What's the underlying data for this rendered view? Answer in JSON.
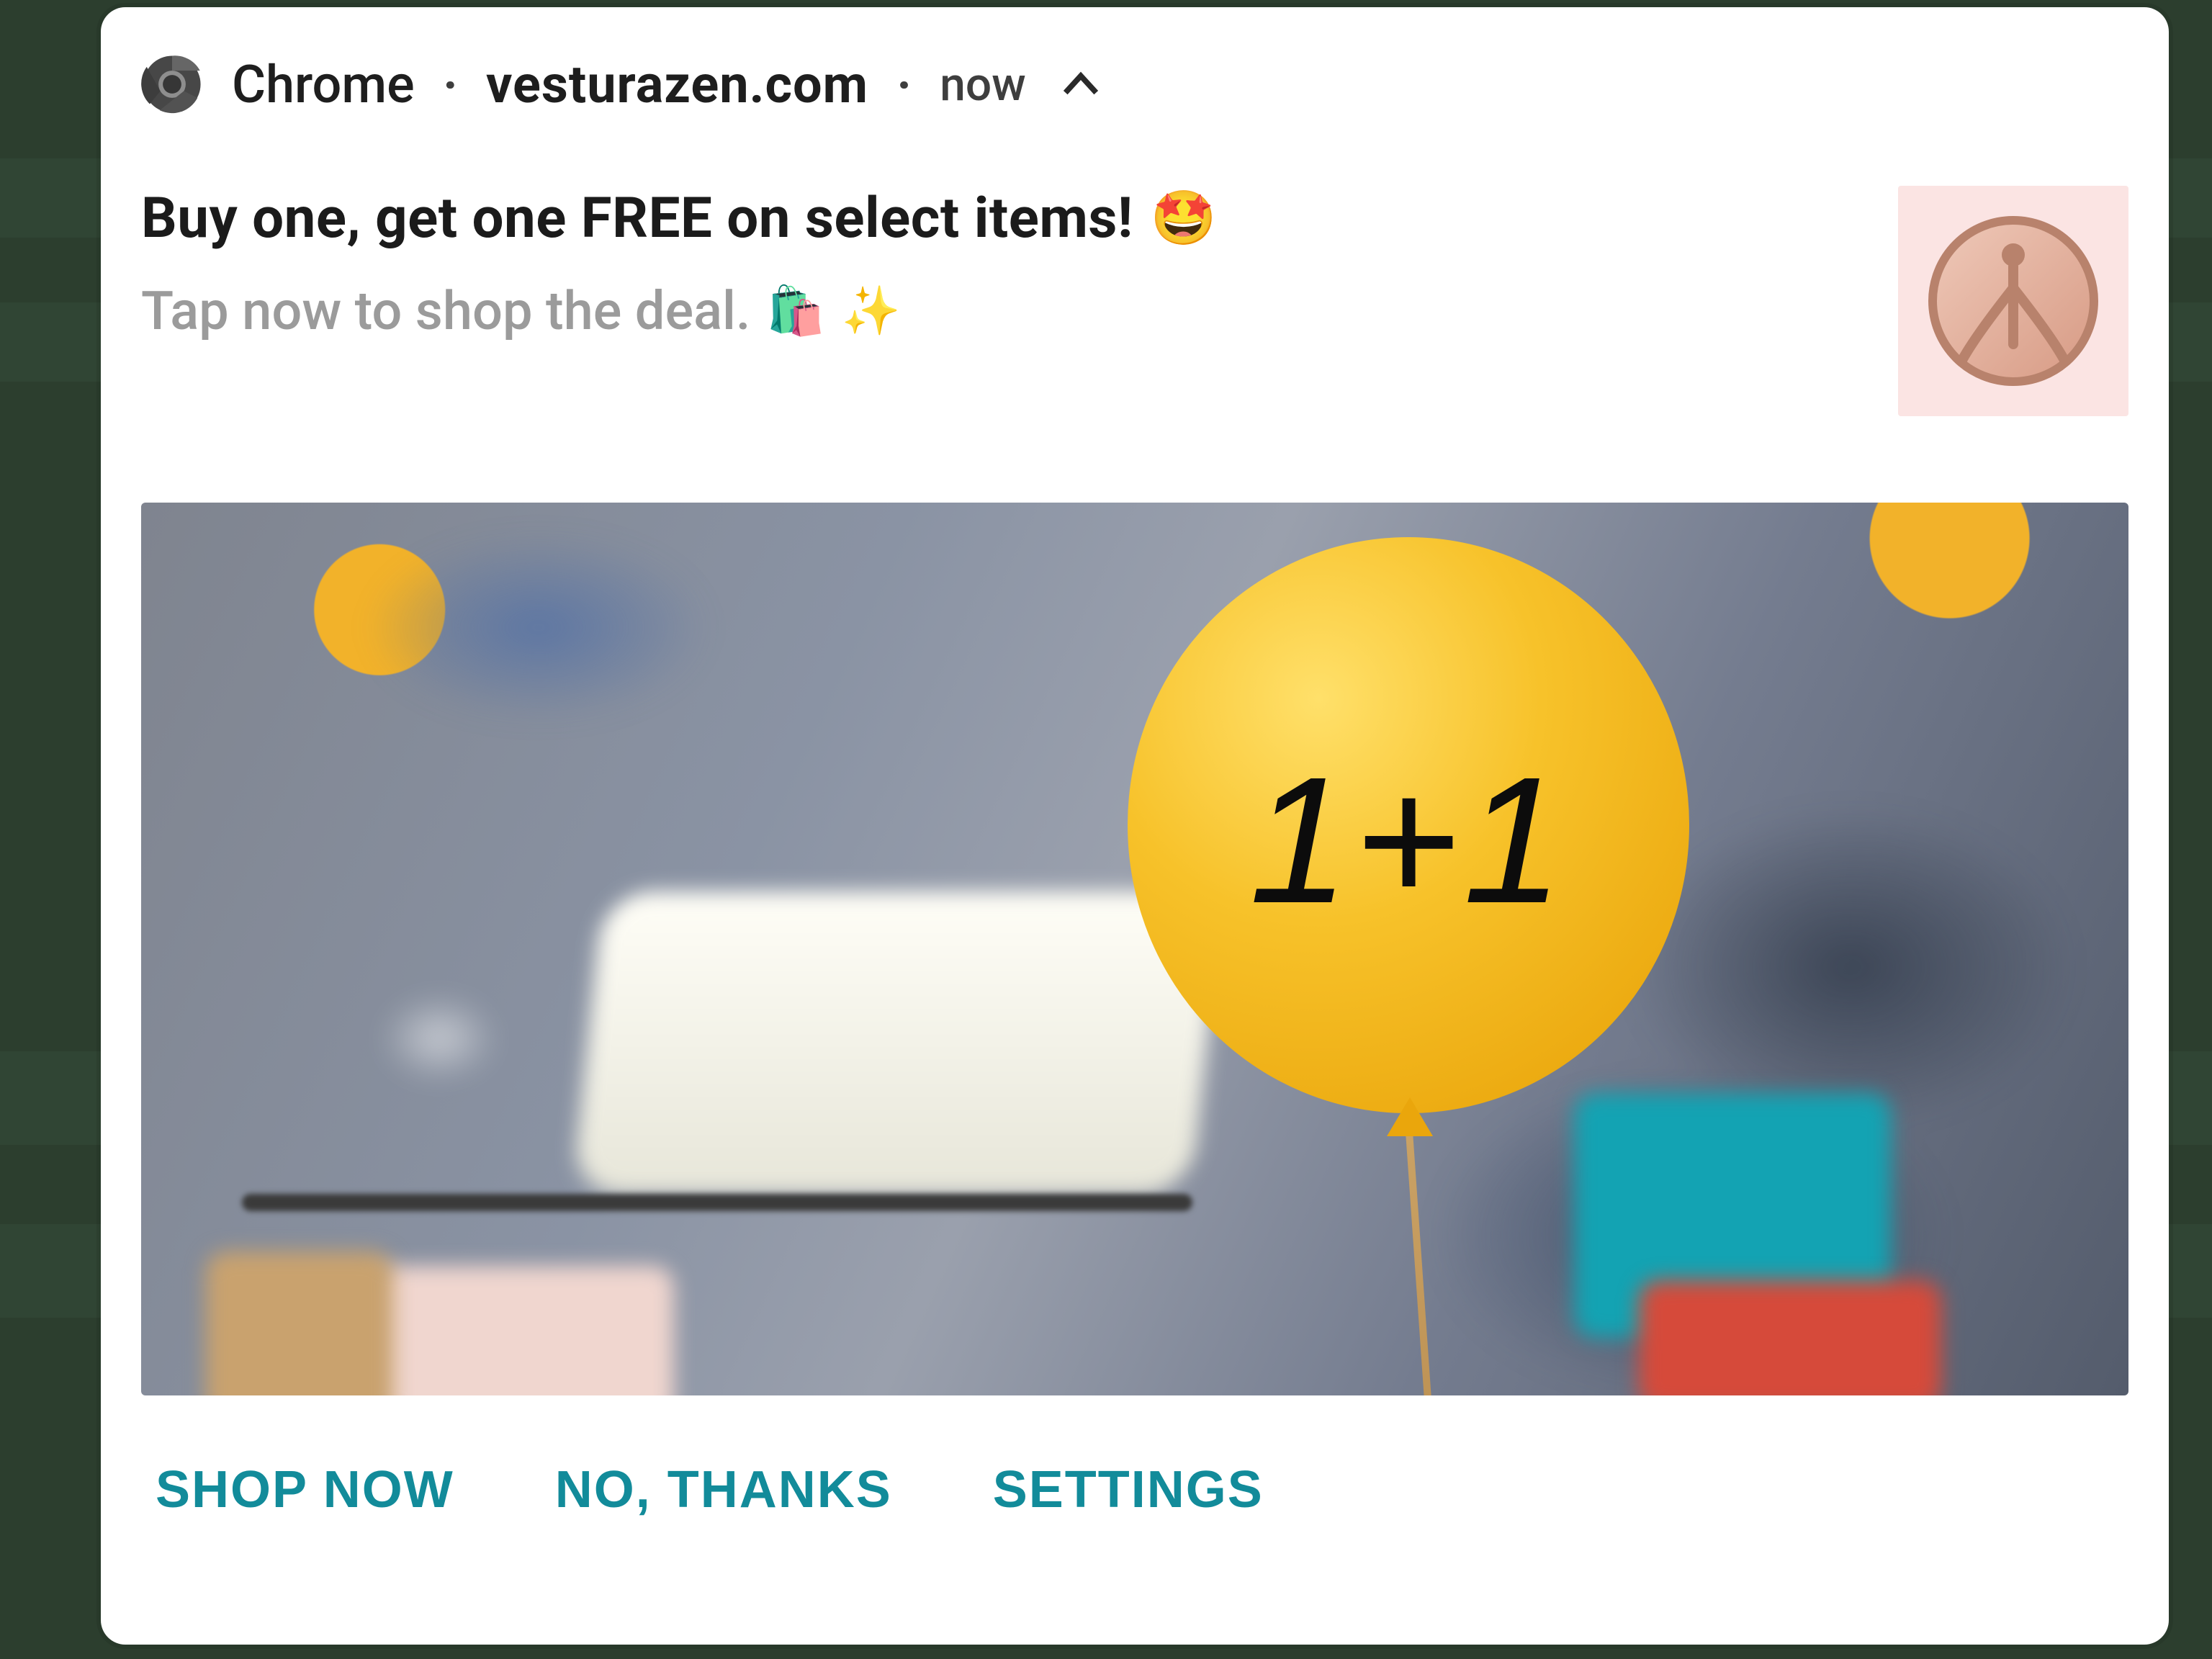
{
  "header": {
    "app": "Chrome",
    "site": "vesturazen.com",
    "time": "now"
  },
  "notification": {
    "title": "Buy one, get one FREE on select items!",
    "title_emoji": "🤩",
    "subtitle": "Tap now to shop the deal.",
    "subtitle_emojis": [
      "🛍️",
      "✨"
    ]
  },
  "hero": {
    "balloon_text": "1+1"
  },
  "actions": {
    "primary": "SHOP NOW",
    "secondary": "NO, THANKS",
    "settings": "SETTINGS"
  },
  "colors": {
    "background": "#2c3e2e",
    "card": "#ffffff",
    "subtitle": "#9b9b9b",
    "action": "#128b9a",
    "balloon": "#f7c22a",
    "brand_bg": "#fbe4e3",
    "brand_stroke": "#b8826c"
  }
}
